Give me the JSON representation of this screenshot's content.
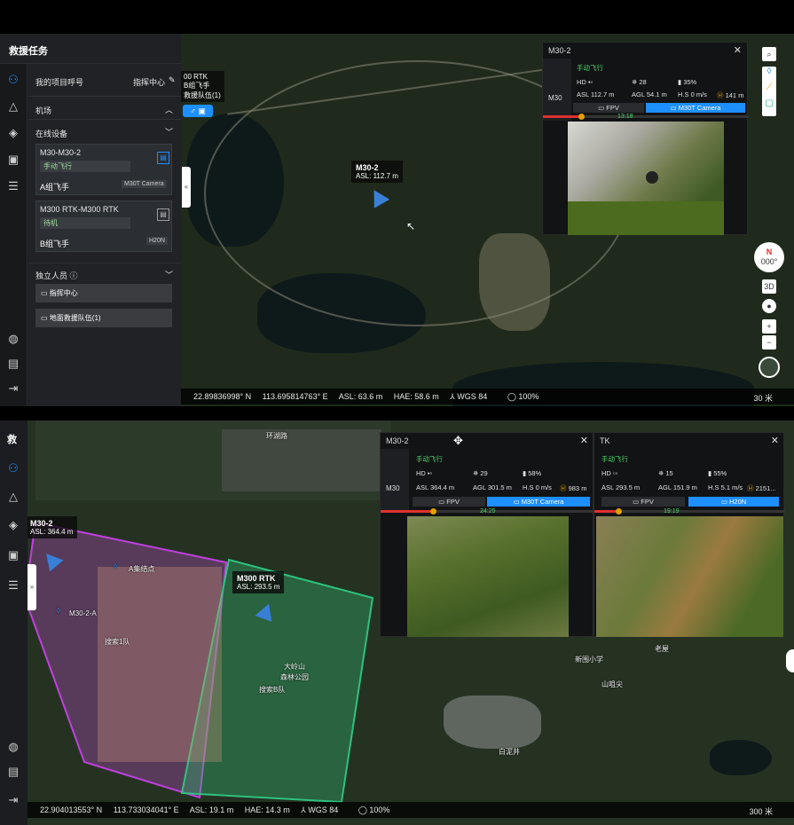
{
  "top": {
    "sidebar": {
      "title": "救援任务",
      "project_label": "我的项目呼号",
      "command_center_link": "指挥中心",
      "section_airport": "机场",
      "section_online": "在线设备",
      "devices": [
        {
          "name": "M30-M30-2",
          "status": "手动飞行",
          "pilot": "A组飞手",
          "payload": "M30T Camera"
        },
        {
          "name": "M300 RTK-M300 RTK",
          "status": "待机",
          "pilot": "B组飞手",
          "payload": "H20N"
        }
      ],
      "section_people": "独立人员",
      "people": [
        "指挥中心",
        "地面救援队伍(1)"
      ]
    },
    "map_marker": {
      "title": "M30-2",
      "asl": "ASL: 112.7 m"
    },
    "cutoff_label": {
      "line1": "00 RTK",
      "line2": "B组飞手",
      "line3": "救援队伍(1)"
    },
    "popup": {
      "title": "M30-2",
      "device": "M30",
      "mode": "手动飞行",
      "signal": "HD",
      "satellites": "28",
      "battery": "35%",
      "asl": "ASL 112.7 m",
      "agl": "AGL 54.1 m",
      "hs": "H.S 0 m/s",
      "dist": "141 m",
      "tab_fpv": "FPV",
      "tab_camera": "M30T Camera",
      "time": "13:18"
    },
    "status": {
      "lat": "22.89836998° N",
      "lng": "113.695814763° E",
      "asl": "ASL: 63.6 m",
      "hae": "HAE: 58.6 m",
      "datum": "WGS 84",
      "pct": "100%",
      "scale": "30 米"
    },
    "compass": {
      "dir": "N",
      "deg": "000°"
    },
    "view3d": "3D"
  },
  "bottom": {
    "sidebar_title": "救",
    "road_label": "环湖路",
    "drones": [
      {
        "title": "M30-2",
        "asl": "ASL: 364.4 m"
      },
      {
        "title": "M300 RTK",
        "asl": "ASL: 293.5 m"
      }
    ],
    "map_labels": [
      "A集结点",
      "M30-2-A",
      "搜索1队",
      "大岭山",
      "森林公园",
      "搜索B队",
      "新围小学",
      "老屋",
      "山咀尖",
      "白泥井"
    ],
    "popup1": {
      "title": "M30-2",
      "device": "M30",
      "mode": "手动飞行",
      "signal": "HD",
      "satellites": "29",
      "battery": "58%",
      "asl": "ASL 364.4 m",
      "agl": "AGL 301.5 m",
      "hs": "H.S 0 m/s",
      "dist": "983 m",
      "tab_fpv": "FPV",
      "tab_camera": "M30T Camera",
      "time": "24:25"
    },
    "popup2": {
      "title": "TK",
      "mode": "手动飞行",
      "signal": "HD",
      "satellites": "15",
      "battery": "55%",
      "asl": "ASL 293.5 m",
      "agl": "AGL 151.9 m",
      "hs": "H.S 5.1 m/s",
      "dist": "2151...",
      "tab_fpv": "FPV",
      "tab_camera": "H20N",
      "time": "19:19"
    },
    "status": {
      "lat": "22.904013553° N",
      "lng": "113.733034041° E",
      "asl": "ASL: 19.1 m",
      "hae": "HAE: 14.3 m",
      "datum": "WGS 84",
      "pct": "100%",
      "scale": "300 米"
    }
  },
  "colors": {
    "accent": "#1e8fff",
    "zone_purple": "#c040e0",
    "zone_green": "#2ec27e"
  }
}
